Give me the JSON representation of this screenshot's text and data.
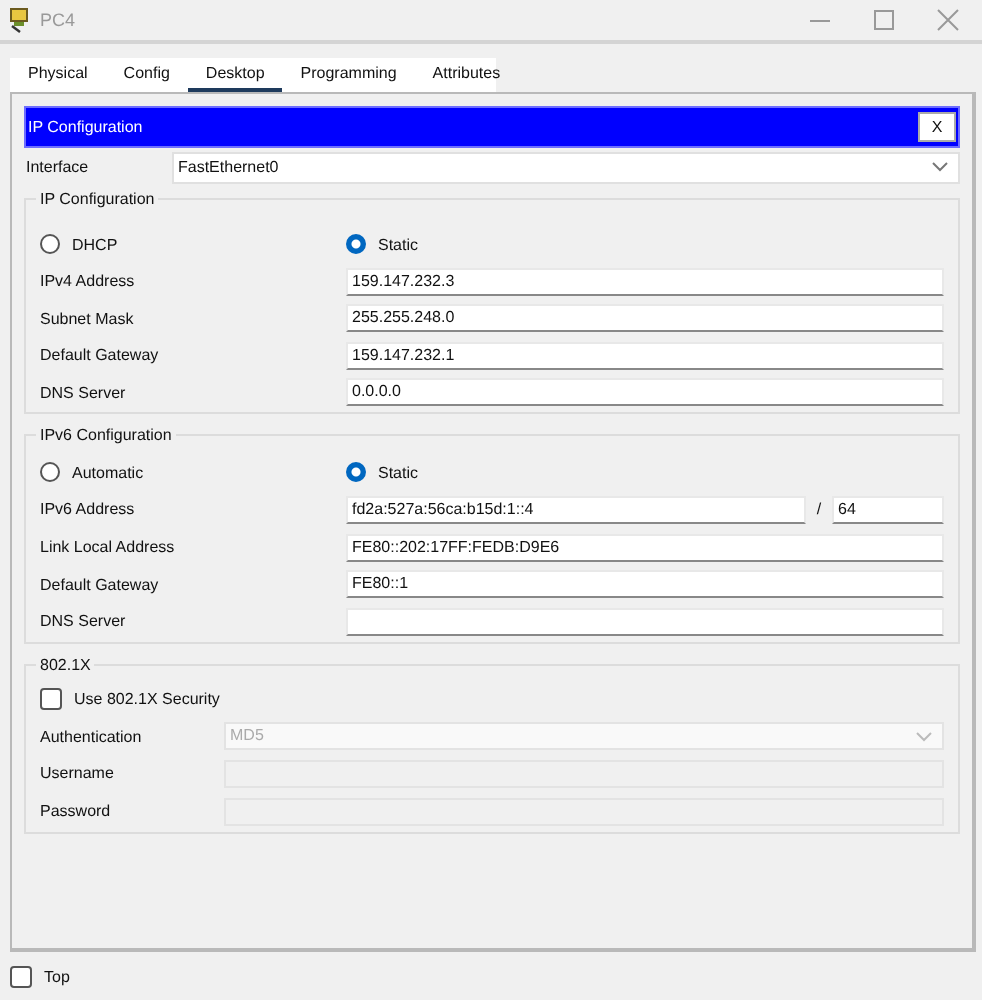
{
  "window": {
    "title": "PC4"
  },
  "tabs": [
    {
      "label": "Physical",
      "selected": false
    },
    {
      "label": "Config",
      "selected": false
    },
    {
      "label": "Desktop",
      "selected": true
    },
    {
      "label": "Programming",
      "selected": false
    },
    {
      "label": "Attributes",
      "selected": false
    }
  ],
  "panel": {
    "title": "IP Configuration",
    "close_label": "X"
  },
  "interface": {
    "label": "Interface",
    "value": "FastEthernet0"
  },
  "ipv4": {
    "title": "IP Configuration",
    "radios": [
      {
        "label": "DHCP",
        "selected": false
      },
      {
        "label": "Static",
        "selected": true
      }
    ],
    "fields": [
      {
        "label": "IPv4 Address",
        "value": "159.147.232.3"
      },
      {
        "label": "Subnet Mask",
        "value": "255.255.248.0"
      },
      {
        "label": "Default Gateway",
        "value": "159.147.232.1"
      },
      {
        "label": "DNS Server",
        "value": "0.0.0.0"
      }
    ]
  },
  "ipv6": {
    "title": "IPv6 Configuration",
    "radios": [
      {
        "label": "Automatic",
        "selected": false
      },
      {
        "label": "Static",
        "selected": true
      }
    ],
    "fields": [
      {
        "label": "IPv6 Address",
        "value": "fd2a:527a:56ca:b15d:1::4",
        "separator": "/",
        "prefix": "64"
      },
      {
        "label": "Link Local Address",
        "value": "FE80::202:17FF:FEDB:D9E6"
      },
      {
        "label": "Default Gateway",
        "value": "FE80::1"
      },
      {
        "label": "DNS Server"
      }
    ]
  },
  "dot1x": {
    "title": "802.1X",
    "checkbox": {
      "label": "Use 802.1X Security",
      "checked": false
    },
    "fields": [
      {
        "label": "Authentication",
        "kind": "select",
        "value": "MD5",
        "disabled": true
      },
      {
        "label": "Username",
        "kind": "text",
        "disabled": true
      },
      {
        "label": "Password",
        "kind": "text",
        "disabled": true
      }
    ]
  },
  "top_checkbox": {
    "label": "Top",
    "checked": false
  }
}
